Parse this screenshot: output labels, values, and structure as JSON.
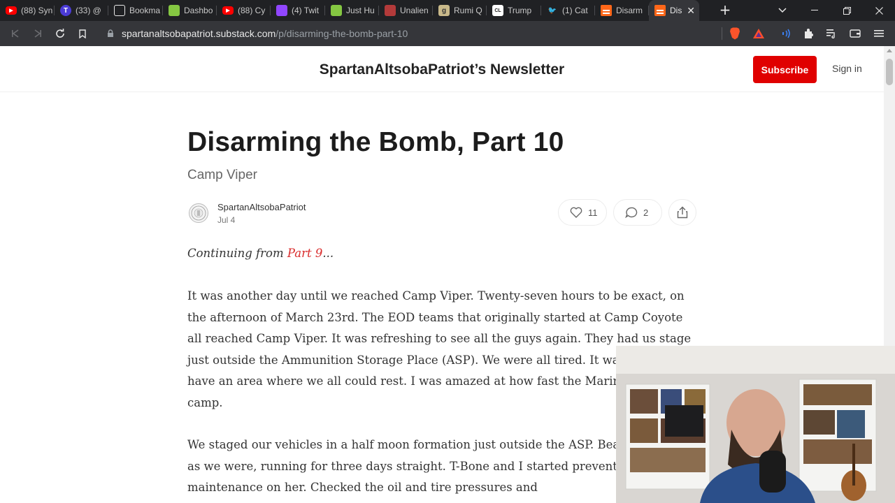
{
  "browser": {
    "tabs": [
      {
        "label": "(88) Syn",
        "icon": "youtube-icon",
        "color": "#ff0000"
      },
      {
        "label": "(33) @",
        "icon": "twitch-t-icon",
        "color": "#4b3bd6"
      },
      {
        "label": "Bookma",
        "icon": "bookmark-icon",
        "color": "#e8e8e8"
      },
      {
        "label": "Dashbo",
        "icon": "rumble-r-icon",
        "color": "#85c742"
      },
      {
        "label": "(88) Cy",
        "icon": "youtube-icon",
        "color": "#ff0000"
      },
      {
        "label": "(4) Twit",
        "icon": "twitch-icon",
        "color": "#9146ff"
      },
      {
        "label": "Just Hu",
        "icon": "rumble-play-icon",
        "color": "#85c742"
      },
      {
        "label": "Unalien",
        "icon": "site-icon",
        "color": "#b33a3a"
      },
      {
        "label": "Rumi Q",
        "icon": "g-icon",
        "color": "#c9b98a"
      },
      {
        "label": "Trump",
        "icon": "cl-icon",
        "color": "#ffffff"
      },
      {
        "label": "(1) Cat",
        "icon": "twitter-icon",
        "color": "#1d9bf0"
      },
      {
        "label": "Disarm",
        "icon": "substack-icon",
        "color": "#ff6719"
      },
      {
        "label": "Dis",
        "icon": "substack-icon",
        "color": "#ff6719",
        "active": true
      }
    ],
    "url_host": "spartanaltsobapatriot.substack.com",
    "url_path": "/p/disarming-the-bomb-part-10"
  },
  "header": {
    "title": "SpartanAltsobaPatriot’s Newsletter",
    "subscribe_label": "Subscribe",
    "signin_label": "Sign in",
    "accent_color": "#e00000"
  },
  "post": {
    "title": "Disarming the Bomb, Part 10",
    "subtitle": "Camp Viper",
    "author": "SpartanAltsobaPatriot",
    "date": "Jul 4",
    "likes": "11",
    "comments": "2",
    "intro_prefix": "Continuing from ",
    "intro_link": "Part 9",
    "intro_suffix": "...",
    "paragraph1": "It was another day until we reached Camp Viper. Twenty-seven hours to be exact, on the afternoon of March 23rd. The EOD teams that originally started at Camp Coyote all reached Camp Viper. It was refreshing to see all the guys again. They had us stage just outside the Ammunition Storage Place (ASP). We were all tired. It was good to have an area where we all could rest. I was amazed at how fast the Marines set up the camp.",
    "paragraph2": "We staged our vehicles in a half moon formation just outside the ASP. Beat and tired as we were, running for three days straight. T-Bone and I started preventative maintenance on her. Checked the oil and tire pressures and"
  }
}
